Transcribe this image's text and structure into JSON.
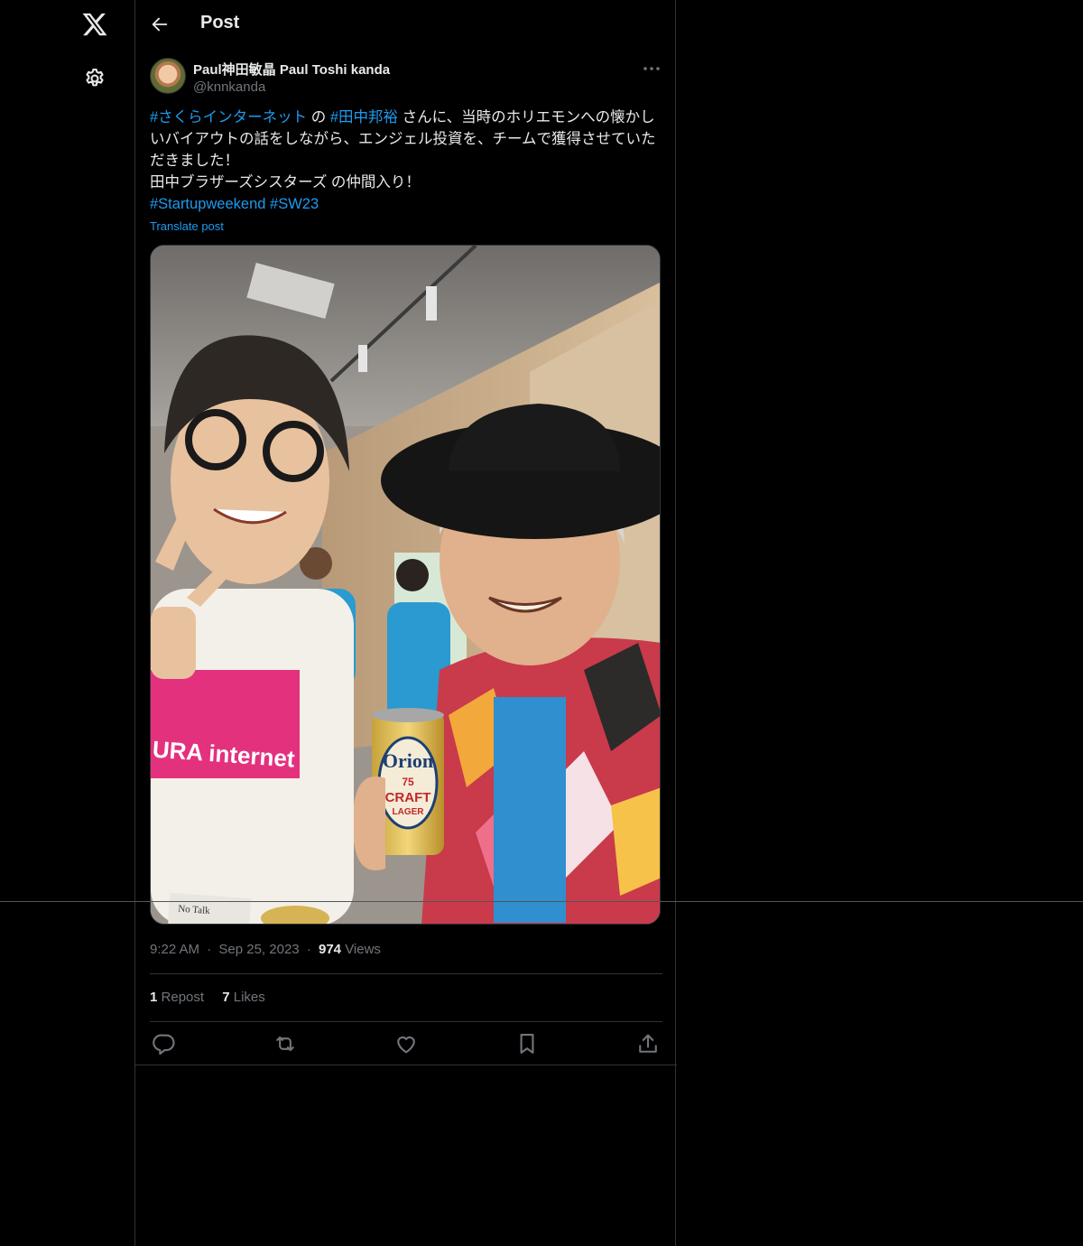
{
  "header": {
    "title": "Post"
  },
  "post": {
    "author": {
      "display_name": "Paul神田敏晶 Paul Toshi kanda",
      "handle": "@knnkanda"
    },
    "text": {
      "tag1": "#さくらインターネット",
      "seg1": " の ",
      "tag2": "#田中邦裕",
      "seg2": " さんに、当時のホリエモンへの懐かしいバイアウトの話をしながら、エンジェル投資を、チームで獲得させていただきました！\n田中ブラザーズシスターズ の仲間入り！\n",
      "tag3": "#Startupweekend",
      "seg3": " ",
      "tag4": "#SW23"
    },
    "translate_label": "Translate post",
    "photo": {
      "shirt_text": "URA internet",
      "can_brand": "Orion",
      "can_number": "75",
      "can_line1": "CRAFT",
      "can_line2": "LAGER",
      "badge_text": "No Talk\nAll Action!"
    },
    "time": "9:22 AM",
    "date": "Sep 25, 2023",
    "sep": "·",
    "views_count": "974",
    "views_label": "Views",
    "reposts_count": "1",
    "reposts_label": "Repost",
    "likes_count": "7",
    "likes_label": "Likes"
  },
  "icons": {
    "logo": "x-logo-icon",
    "settings": "gear-icon",
    "back": "back-arrow-icon",
    "more": "more-icon",
    "reply": "reply-icon",
    "repost": "repost-icon",
    "like": "heart-icon",
    "bookmark": "bookmark-icon",
    "share": "share-icon"
  },
  "colors": {
    "background": "#000000",
    "accent": "#1d9bf0",
    "muted": "#71767b",
    "text": "#e7e9ea",
    "border": "#2f3336"
  }
}
